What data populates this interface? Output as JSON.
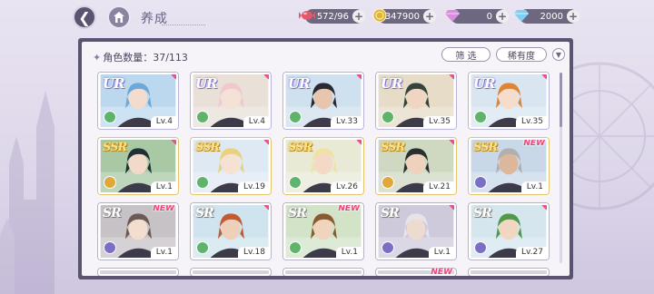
{
  "header": {
    "title": "养成",
    "resources": [
      {
        "name": "stamina",
        "value": "572/96",
        "icon": "candy-icon",
        "color": "#e05a6a"
      },
      {
        "name": "gold",
        "value": "3347900",
        "icon": "coin-icon",
        "color": "#e0b43a"
      },
      {
        "name": "premium-diamond",
        "value": "0",
        "icon": "pink-diamond-icon",
        "color": "#d98ce0"
      },
      {
        "name": "diamond",
        "value": "2000",
        "icon": "blue-diamond-icon",
        "color": "#7fd0f0"
      }
    ]
  },
  "panel": {
    "count_label": "角色数量：37/113",
    "filter_label": "筛 选",
    "rarity_label": "稀有度",
    "scroll_position": 0.0
  },
  "cards": [
    {
      "rarity": "UR",
      "level": "Lv.4",
      "new": false,
      "attr_color": "#5fb36b",
      "bg": "#bcd8ee",
      "hair": "#6aa9d8",
      "skin": "#f3dccd"
    },
    {
      "rarity": "UR",
      "level": "Lv.4",
      "new": false,
      "attr_color": "#5fb36b",
      "bg": "#e9e1d8",
      "hair": "#f2c8cf",
      "skin": "#f5e1d6"
    },
    {
      "rarity": "UR",
      "level": "Lv.33",
      "new": false,
      "attr_color": "#5fb36b",
      "bg": "#cfe0ee",
      "hair": "#2a2a35",
      "skin": "#e8c6ae"
    },
    {
      "rarity": "UR",
      "level": "Lv.35",
      "new": false,
      "attr_color": "#5fb36b",
      "bg": "#e6dcc8",
      "hair": "#36443e",
      "skin": "#f0d6c2"
    },
    {
      "rarity": "UR",
      "level": "Lv.35",
      "new": false,
      "attr_color": "#5fb36b",
      "bg": "#d9e6f2",
      "hair": "#e08434",
      "skin": "#f5dccb"
    },
    {
      "rarity": "SSR",
      "level": "Lv.1",
      "new": false,
      "attr_color": "#e0a83a",
      "bg": "#a9c9a4",
      "hair": "#203038",
      "skin": "#f2d9c8"
    },
    {
      "rarity": "SSR",
      "level": "Lv.19",
      "new": false,
      "attr_color": "#5fb36b",
      "bg": "#dfe9f4",
      "hair": "#e9d27e",
      "skin": "#f6e2d3"
    },
    {
      "rarity": "SSR",
      "level": "Lv.26",
      "new": false,
      "attr_color": "#5fb36b",
      "bg": "#e9ead6",
      "hair": "#f0e2a6",
      "skin": "#f4dac6"
    },
    {
      "rarity": "SSR",
      "level": "Lv.21",
      "new": false,
      "attr_color": "#e0a83a",
      "bg": "#cfd9c2",
      "hair": "#2a3030",
      "skin": "#efd2bd"
    },
    {
      "rarity": "SSR",
      "level": "Lv.1",
      "new": true,
      "attr_color": "#7a6fc4",
      "bg": "#c9d8e8",
      "hair": "#b0b0b0",
      "skin": "#dcb79c"
    },
    {
      "rarity": "SR",
      "level": "Lv.1",
      "new": true,
      "attr_color": "#7a6fc4",
      "bg": "#c7c2c6",
      "hair": "#6b5a55",
      "skin": "#f3ddcf"
    },
    {
      "rarity": "SR",
      "level": "Lv.18",
      "new": false,
      "attr_color": "#5fb36b",
      "bg": "#cfe4ee",
      "hair": "#c45a32",
      "skin": "#efcfb7"
    },
    {
      "rarity": "SR",
      "level": "Lv.1",
      "new": true,
      "attr_color": "#5fb36b",
      "bg": "#d2e3c8",
      "hair": "#8a5a30",
      "skin": "#f1d4bd"
    },
    {
      "rarity": "SR",
      "level": "Lv.1",
      "new": false,
      "attr_color": "#7a6fc4",
      "bg": "#cfcadb",
      "hair": "#e4e4ea",
      "skin": "#eedbd0"
    },
    {
      "rarity": "SR",
      "level": "Lv.27",
      "new": false,
      "attr_color": "#7a6fc4",
      "bg": "#d6e6ef",
      "hair": "#4f9a48",
      "skin": "#f1d6c2"
    }
  ],
  "partial_row": {
    "new": true
  }
}
